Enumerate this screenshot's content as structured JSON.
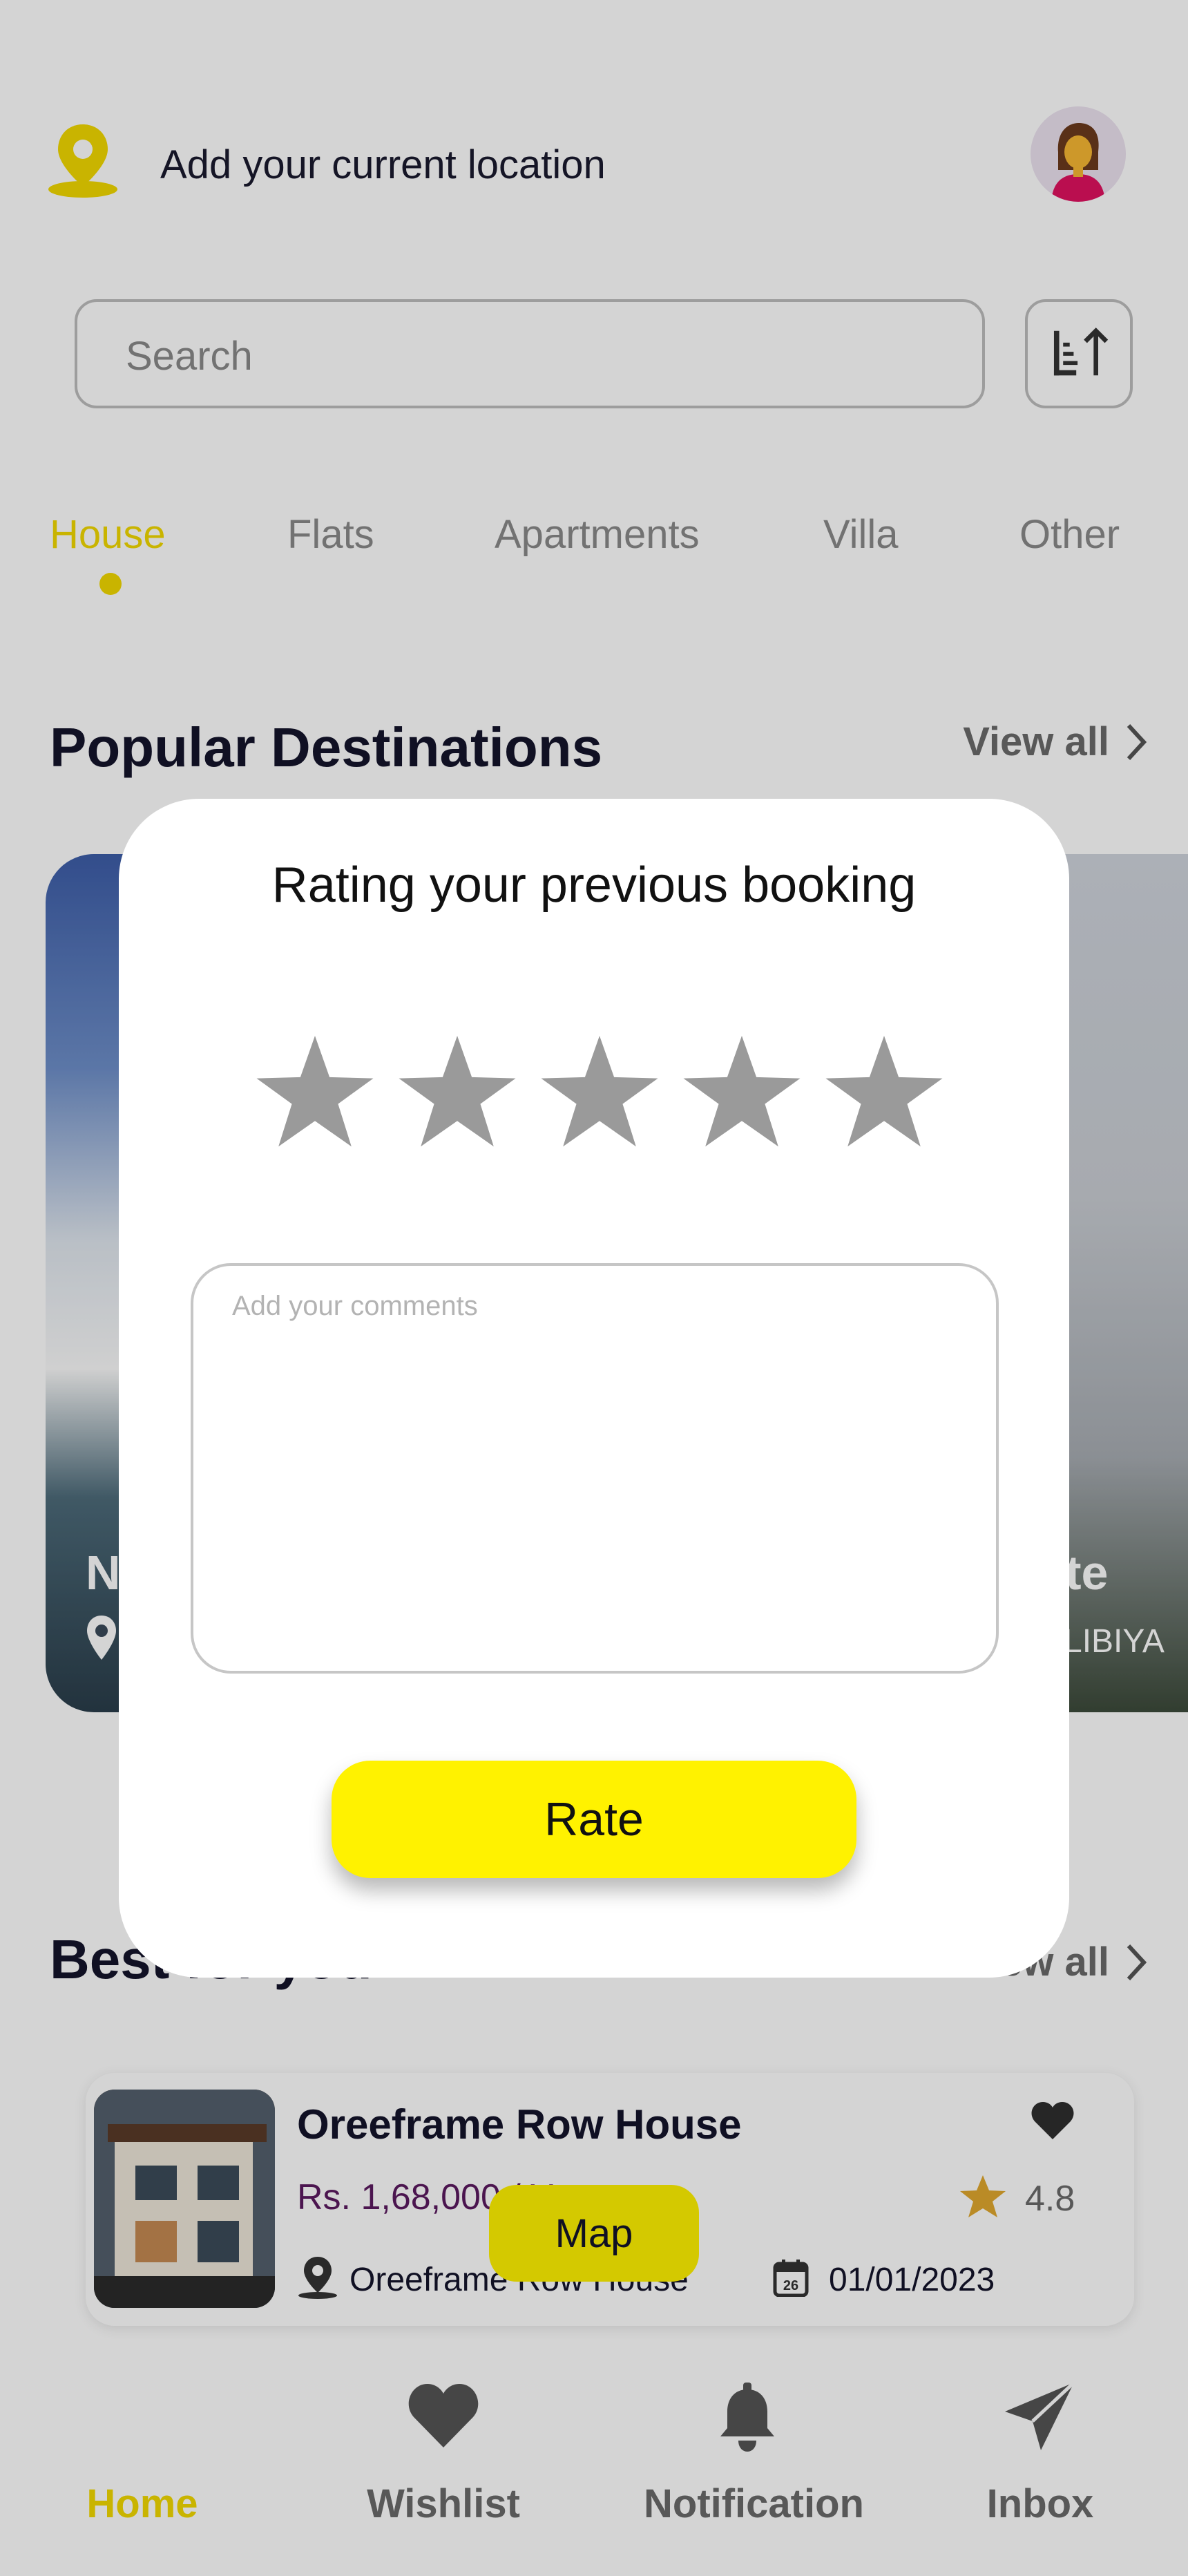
{
  "header": {
    "location_text": "Add your current location",
    "pin_icon": "location-pin-icon",
    "avatar_icon": "user-avatar-icon"
  },
  "search": {
    "placeholder": "Search",
    "sort_icon": "sort-ascending-icon"
  },
  "tabs": [
    {
      "label": "House",
      "active": true
    },
    {
      "label": "Flats",
      "active": false
    },
    {
      "label": "Apartments",
      "active": false
    },
    {
      "label": "Villa",
      "active": false
    },
    {
      "label": "Other",
      "active": false
    }
  ],
  "popular": {
    "title": "Popular Destinations",
    "view_all": "View all",
    "cards": [
      {
        "title_fragment": "N",
        "sub_fragment": ""
      },
      {
        "title_fragment": "tate",
        "sub_fragment": "LIBIYA"
      }
    ]
  },
  "best": {
    "title": "Best for you",
    "view_all": "View all",
    "item": {
      "name": "Oreeframe Row House",
      "price": "Rs. 1,68,000 / Year",
      "rating": "4.8",
      "location": "Oreeframe Row House",
      "date": "01/01/2023"
    },
    "map_label": "Map"
  },
  "bottom_nav": [
    {
      "label": "Home",
      "icon": "home-icon",
      "active": true
    },
    {
      "label": "Wishlist",
      "icon": "heart-icon",
      "active": false
    },
    {
      "label": "Notification",
      "icon": "bell-icon",
      "active": false
    },
    {
      "label": "Inbox",
      "icon": "send-icon",
      "active": false
    }
  ],
  "modal": {
    "title": "Rating your previous booking",
    "stars_total": 5,
    "stars_selected": 0,
    "comments_placeholder": "Add your comments",
    "rate_button": "Rate"
  },
  "colors": {
    "accent_yellow": "#fff200",
    "active_tab": "#f2d900",
    "price_purple": "#5b1a60",
    "star_inactive": "#9a9a9a"
  }
}
